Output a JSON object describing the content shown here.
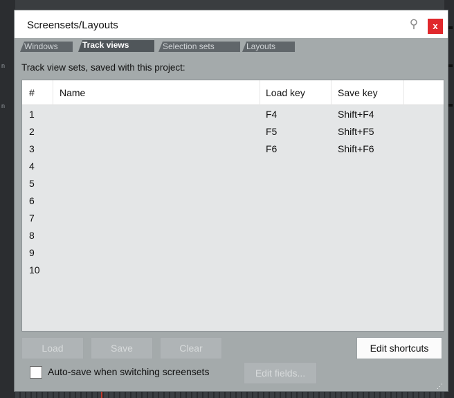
{
  "window": {
    "title": "Screensets/Layouts",
    "pin_icon": "pin-icon",
    "close_label": "x"
  },
  "tabs": [
    {
      "label": "Windows",
      "active": false
    },
    {
      "label": "Track views",
      "active": true
    },
    {
      "label": "Selection sets",
      "active": false
    },
    {
      "label": "Layouts",
      "active": false
    }
  ],
  "subtitle": "Track view sets, saved with this project:",
  "table": {
    "columns": [
      "#",
      "Name",
      "Load key",
      "Save key"
    ],
    "rows": [
      {
        "num": "1",
        "name": "",
        "load_key": "F4",
        "save_key": "Shift+F4"
      },
      {
        "num": "2",
        "name": "",
        "load_key": "F5",
        "save_key": "Shift+F5"
      },
      {
        "num": "3",
        "name": "",
        "load_key": "F6",
        "save_key": "Shift+F6"
      },
      {
        "num": "4",
        "name": "",
        "load_key": "",
        "save_key": ""
      },
      {
        "num": "5",
        "name": "",
        "load_key": "",
        "save_key": ""
      },
      {
        "num": "6",
        "name": "",
        "load_key": "",
        "save_key": ""
      },
      {
        "num": "7",
        "name": "",
        "load_key": "",
        "save_key": ""
      },
      {
        "num": "8",
        "name": "",
        "load_key": "",
        "save_key": ""
      },
      {
        "num": "9",
        "name": "",
        "load_key": "",
        "save_key": ""
      },
      {
        "num": "10",
        "name": "",
        "load_key": "",
        "save_key": ""
      }
    ]
  },
  "buttons": {
    "load": "Load",
    "save": "Save",
    "clear": "Clear",
    "edit_shortcuts": "Edit shortcuts",
    "edit_fields": "Edit fields..."
  },
  "autosave": {
    "label": "Auto-save when switching screensets",
    "checked": false
  },
  "colors": {
    "window_bg": "#a4aaab",
    "close_button": "#e0282c",
    "list_bg": "#e4e6e7"
  }
}
